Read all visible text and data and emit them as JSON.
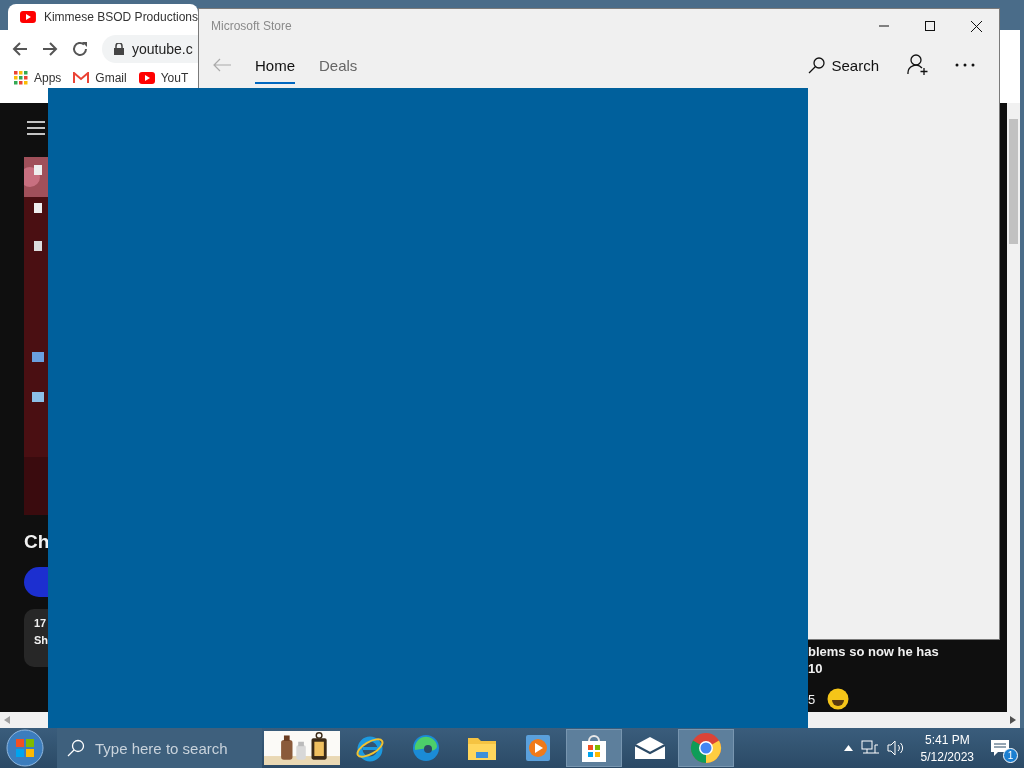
{
  "browser": {
    "tab_title": "Kimmese BSOD Productions",
    "address": "youtube.c",
    "bookmarks": [
      {
        "kind": "apps",
        "label": "Apps"
      },
      {
        "kind": "gmail",
        "label": "Gmail"
      },
      {
        "kind": "youtube",
        "label": "YouT"
      }
    ]
  },
  "youtube": {
    "heading": "Ch",
    "card_lines": [
      "17",
      "Sh"
    ],
    "comment_lines": [
      "blems so now he has",
      "10"
    ],
    "like_count": "5"
  },
  "store": {
    "title": "Microsoft Store",
    "tabs": [
      {
        "label": "Home",
        "selected": true
      },
      {
        "label": "Deals",
        "selected": false
      }
    ],
    "search_label": "Search"
  },
  "taskbar": {
    "search_placeholder": "Type here to search",
    "apps": [
      {
        "kind": "thumbnail",
        "active": false
      },
      {
        "kind": "ie",
        "active": false
      },
      {
        "kind": "edge",
        "active": false
      },
      {
        "kind": "explorer",
        "active": false
      },
      {
        "kind": "media",
        "active": false
      },
      {
        "kind": "store",
        "active": true
      },
      {
        "kind": "mail",
        "active": false
      },
      {
        "kind": "chrome",
        "active": true
      }
    ],
    "time": "5:41 PM",
    "date": "5/12/2023",
    "notification_count": "1"
  }
}
